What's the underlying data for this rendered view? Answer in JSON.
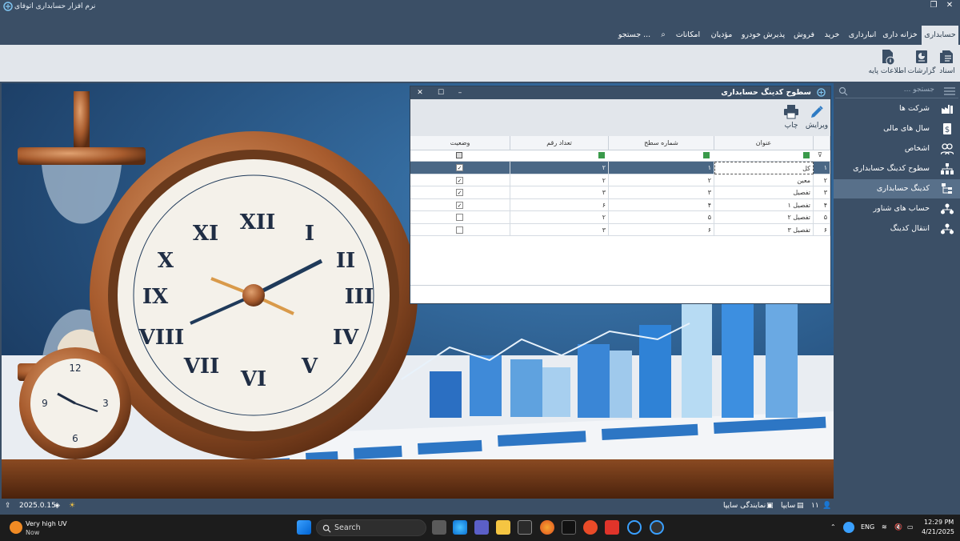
{
  "app": {
    "title": "نرم افزار حسابداری اتوفای"
  },
  "menu": [
    "حسابداری",
    "خزانه داری",
    "انبارداری",
    "خرید",
    "فروش",
    "پذیرش خودرو",
    "مؤدیان",
    "امکانات",
    "جستجو ..."
  ],
  "ribbon": {
    "docs": "اسناد",
    "reports": "گزارشات",
    "base": "اطلاعات پایه"
  },
  "sidebar": {
    "search_placeholder": "جستجو ...",
    "items": [
      "شرکت ها",
      "سال های مالی",
      "اشخاص",
      "سطوح کدینگ حسابداری",
      "کدینگ حسابداری",
      "حساب های شناور",
      "انتقال کدینگ"
    ]
  },
  "dialog": {
    "title": "سطوح کدینگ حسابداری",
    "edit": "ویرایش",
    "print": "چاپ",
    "columns": {
      "row": "",
      "title": "عنوان",
      "level": "شماره سطح",
      "digits": "تعداد رقم",
      "status": "وضعیت"
    },
    "rows": [
      {
        "n": "۱",
        "title": "کل",
        "level": "۱",
        "digits": "۲",
        "status": true
      },
      {
        "n": "۲",
        "title": "معین",
        "level": "۲",
        "digits": "۲",
        "status": true
      },
      {
        "n": "۳",
        "title": "تفصیل",
        "level": "۳",
        "digits": "۳",
        "status": true
      },
      {
        "n": "۴",
        "title": "تفصیل ۱",
        "level": "۴",
        "digits": "۶",
        "status": true
      },
      {
        "n": "۵",
        "title": "تفصیل ۲",
        "level": "۵",
        "digits": "۲",
        "status": false
      },
      {
        "n": "۶",
        "title": "تفصیل ۳",
        "level": "۶",
        "digits": "۳",
        "status": false
      }
    ]
  },
  "status": {
    "version": "2025.0.15",
    "user_count": "۱۱",
    "company": "سایپا",
    "agency": "نمایندگی سایپا"
  },
  "taskbar": {
    "weather": "Very high UV",
    "weather_sub": "Now",
    "search": "Search",
    "lang": "ENG",
    "time": "12:29 PM",
    "date": "4/21/2025"
  }
}
